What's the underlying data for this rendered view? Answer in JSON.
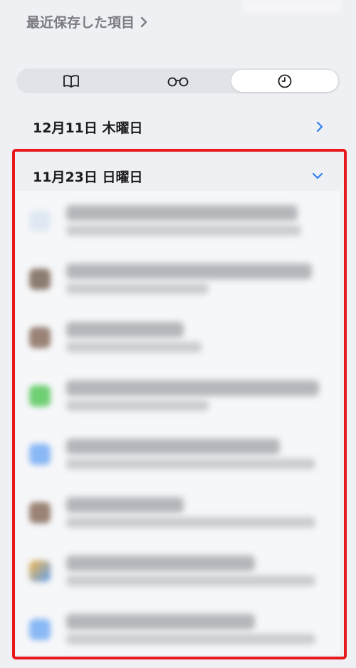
{
  "header": {
    "recent_saved_label": "最近保存した項目"
  },
  "segmented_control": {
    "segments": [
      {
        "name": "bookmarks",
        "icon": "book-icon",
        "selected": false
      },
      {
        "name": "reading-list",
        "icon": "glasses-icon",
        "selected": false
      },
      {
        "name": "history",
        "icon": "clock-icon",
        "selected": true
      }
    ]
  },
  "history": {
    "sections": [
      {
        "date_label": "12月11日 木曜日",
        "expanded": false
      },
      {
        "date_label": "11月23日 日曜日",
        "expanded": true
      }
    ]
  },
  "colors": {
    "accent": "#2f7ff2",
    "highlight": "#e8191d",
    "background": "#eef0f4"
  }
}
